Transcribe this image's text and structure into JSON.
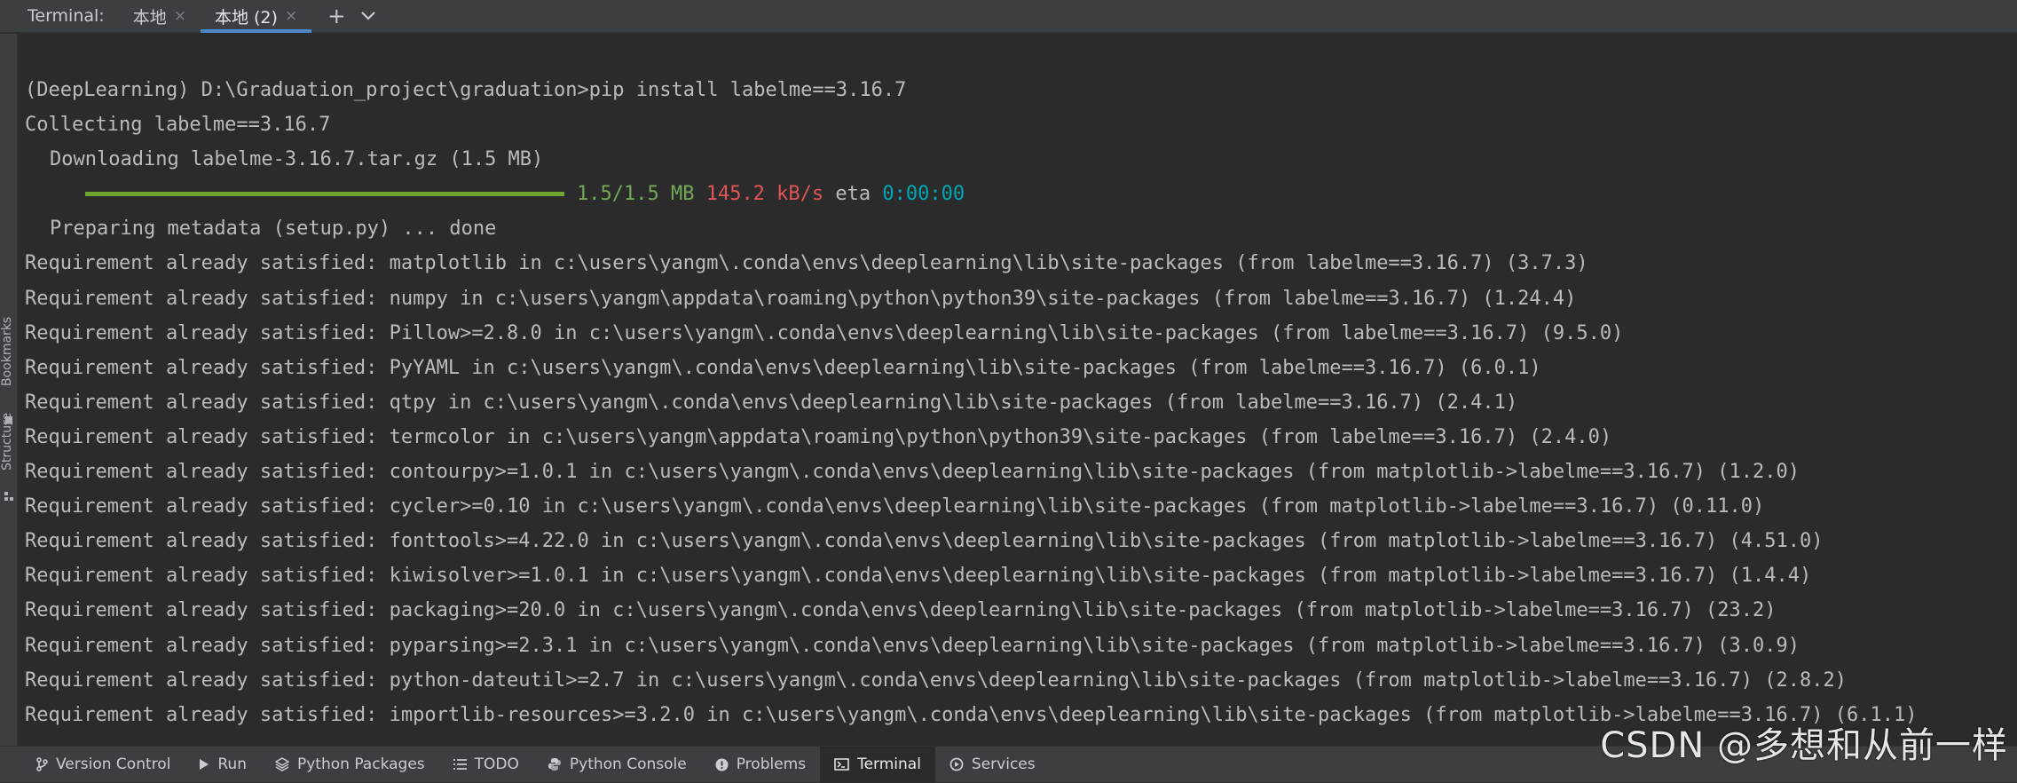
{
  "tabbar": {
    "title": "Terminal:",
    "tabs": [
      {
        "label": "本地",
        "close": "×"
      },
      {
        "label": "本地 (2)",
        "close": "×"
      }
    ],
    "add": "+",
    "menu": "chevron-down"
  },
  "left_strip": {
    "bookmarks": "Bookmarks",
    "structure": "Structure"
  },
  "terminal": {
    "prompt_line": "(DeepLearning) D:\\Graduation_project\\graduation>pip install labelme==3.16.7",
    "collecting": "Collecting labelme==3.16.7",
    "downloading": "Downloading labelme-3.16.7.tar.gz (1.5 MB)",
    "progress": {
      "fraction": 1.0,
      "size": "1.5/1.5 MB",
      "speed": "145.2 kB/s",
      "eta_label": "eta",
      "eta": "0:00:00"
    },
    "preparing": "Preparing metadata (setup.py) ... done",
    "requirements": [
      "Requirement already satisfied: matplotlib in c:\\users\\yangm\\.conda\\envs\\deeplearning\\lib\\site-packages (from labelme==3.16.7) (3.7.3)",
      "Requirement already satisfied: numpy in c:\\users\\yangm\\appdata\\roaming\\python\\python39\\site-packages (from labelme==3.16.7) (1.24.4)",
      "Requirement already satisfied: Pillow>=2.8.0 in c:\\users\\yangm\\.conda\\envs\\deeplearning\\lib\\site-packages (from labelme==3.16.7) (9.5.0)",
      "Requirement already satisfied: PyYAML in c:\\users\\yangm\\.conda\\envs\\deeplearning\\lib\\site-packages (from labelme==3.16.7) (6.0.1)",
      "Requirement already satisfied: qtpy in c:\\users\\yangm\\.conda\\envs\\deeplearning\\lib\\site-packages (from labelme==3.16.7) (2.4.1)",
      "Requirement already satisfied: termcolor in c:\\users\\yangm\\appdata\\roaming\\python\\python39\\site-packages (from labelme==3.16.7) (2.4.0)",
      "Requirement already satisfied: contourpy>=1.0.1 in c:\\users\\yangm\\.conda\\envs\\deeplearning\\lib\\site-packages (from matplotlib->labelme==3.16.7) (1.2.0)",
      "Requirement already satisfied: cycler>=0.10 in c:\\users\\yangm\\.conda\\envs\\deeplearning\\lib\\site-packages (from matplotlib->labelme==3.16.7) (0.11.0)",
      "Requirement already satisfied: fonttools>=4.22.0 in c:\\users\\yangm\\.conda\\envs\\deeplearning\\lib\\site-packages (from matplotlib->labelme==3.16.7) (4.51.0)",
      "Requirement already satisfied: kiwisolver>=1.0.1 in c:\\users\\yangm\\.conda\\envs\\deeplearning\\lib\\site-packages (from matplotlib->labelme==3.16.7) (1.4.4)",
      "Requirement already satisfied: packaging>=20.0 in c:\\users\\yangm\\.conda\\envs\\deeplearning\\lib\\site-packages (from matplotlib->labelme==3.16.7) (23.2)",
      "Requirement already satisfied: pyparsing>=2.3.1 in c:\\users\\yangm\\.conda\\envs\\deeplearning\\lib\\site-packages (from matplotlib->labelme==3.16.7) (3.0.9)",
      "Requirement already satisfied: python-dateutil>=2.7 in c:\\users\\yangm\\.conda\\envs\\deeplearning\\lib\\site-packages (from matplotlib->labelme==3.16.7) (2.8.2)",
      "Requirement already satisfied: importlib-resources>=3.2.0 in c:\\users\\yangm\\.conda\\envs\\deeplearning\\lib\\site-packages (from matplotlib->labelme==3.16.7) (6.1.1)"
    ]
  },
  "statusbar": {
    "items": [
      {
        "label": "Version Control",
        "icon": "branch-icon"
      },
      {
        "label": "Run",
        "icon": "play-icon"
      },
      {
        "label": "Python Packages",
        "icon": "layers-icon"
      },
      {
        "label": "TODO",
        "icon": "list-icon"
      },
      {
        "label": "Python Console",
        "icon": "python-icon"
      },
      {
        "label": "Problems",
        "icon": "info-icon"
      },
      {
        "label": "Terminal",
        "icon": "terminal-icon"
      },
      {
        "label": "Services",
        "icon": "services-icon"
      }
    ]
  },
  "watermark": "CSDN @多想和从前一样",
  "colors": {
    "progress_bar": "#70a630",
    "size_text": "#74a85a",
    "speed_text": "#e05555",
    "eta_text": "#00a8b5",
    "active_tab_underline": "#4a88c7"
  }
}
